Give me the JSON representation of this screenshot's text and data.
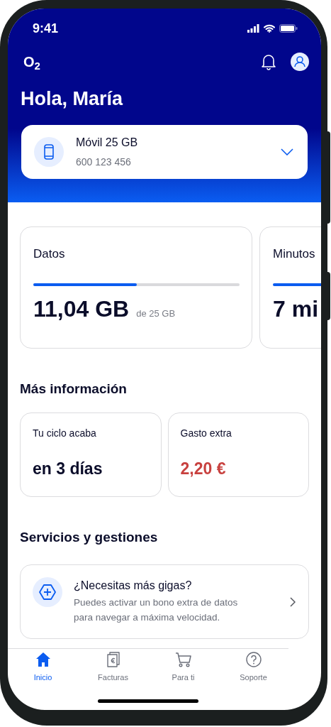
{
  "status_bar": {
    "time": "9:41"
  },
  "header": {
    "logo": "O$_{2}$",
    "greeting": "Hola, María"
  },
  "account": {
    "plan": "Móvil 25 GB",
    "number": "600 123 456",
    "expanded": false
  },
  "usage": [
    {
      "label": "Datos",
      "level": 0.5,
      "value": "11,04 GB",
      "limit": "de 25 GB"
    },
    {
      "label": "Minutos",
      "value": "7 mi"
    }
  ],
  "more_info": {
    "title": "Más información",
    "cards": [
      {
        "label": "Tu ciclo acaba",
        "value": "en 3 días",
        "kind": "normal"
      },
      {
        "label": "Gasto extra",
        "value": "2,20 €",
        "kind": "alert"
      }
    ]
  },
  "services": {
    "title": "Servicios y gestiones",
    "items": [
      {
        "title": "¿Necesitas más gigas?",
        "description": "Puedes activar un bono extra de datos para navegar a máxima velocidad."
      }
    ]
  },
  "nav": [
    {
      "label": "Inicio",
      "kind": "home",
      "selected": true
    },
    {
      "label": "Facturas",
      "kind": "bill",
      "selected": false
    },
    {
      "label": "Para ti",
      "kind": "cart",
      "selected": false
    },
    {
      "label": "Soporte",
      "kind": "help",
      "selected": false
    }
  ]
}
